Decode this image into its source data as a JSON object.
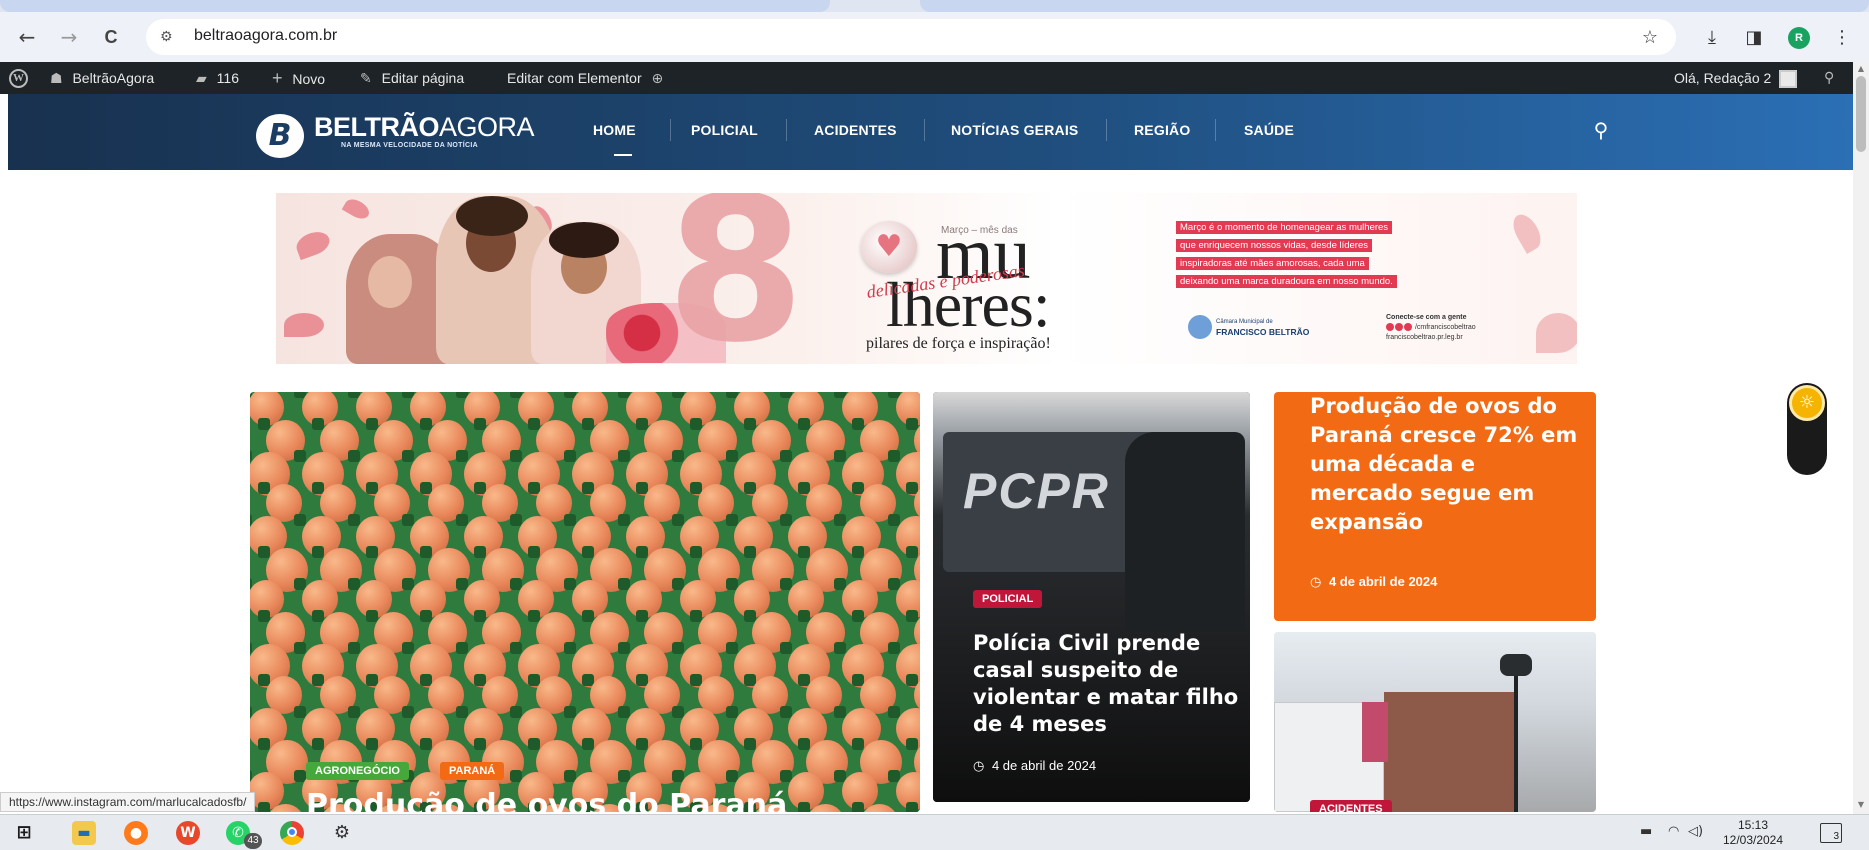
{
  "browser": {
    "url": "beltraoagora.com.br",
    "nav": {
      "back": "←",
      "forward": "→",
      "reload": "C"
    },
    "tools": {
      "bookmark": "☆",
      "download": "⤓",
      "sidebar": "◨",
      "profile_initial": "R",
      "menu": "⋮"
    }
  },
  "adminbar": {
    "site_name": "BeltrãoAgora",
    "comments_count": "116",
    "new_label": "Novo",
    "edit_page_label": "Editar página",
    "elementor_label": "Editar com Elementor",
    "greeting": "Olá, Redação 2"
  },
  "site": {
    "logo_bold": "BELTRÃO",
    "logo_light": "AGORA",
    "logo_mark": "B",
    "tagline": "NA MESMA VELOCIDADE DA NOTÍCIA",
    "menu": [
      "HOME",
      "POLICIAL",
      "ACIDENTES",
      "NOTÍCIAS GERAIS",
      "REGIÃO",
      "SAÚDE"
    ]
  },
  "banner": {
    "number": "8",
    "marco_small": "Março – mês das",
    "word_top": "mu",
    "word_bottom": "lheres:",
    "script": "delicadas e poderosas",
    "subtitle": "pilares de força e inspiração!",
    "lines": [
      "Março é o momento de homenagear as mulheres",
      "que enriquecem nossos vidas, desde líderes",
      "inspiradoras até mães amorosas, cada uma",
      "deixando uma marca duradoura em nosso mundo."
    ],
    "org_small": "Câmara Municipal de",
    "org": "FRANCISCO BELTRÃO",
    "connect": "Conecte-se com a gente",
    "handle": "/cmfranciscobeltrao",
    "site": "franciscobeltrao.pr.leg.br"
  },
  "cards": {
    "main": {
      "tags": [
        "AGRONEGÓCIO",
        "PARANÁ"
      ],
      "title_partial": "Produção de ovos do Paraná"
    },
    "police": {
      "tag": "POLICIAL",
      "title": "Polícia Civil prende casal suspeito de violentar e matar filho de 4 meses",
      "date": "4 de abril de 2024"
    },
    "eggs2": {
      "title": "Produção de ovos do Paraná cresce 72% em uma década e mercado segue em expansão",
      "date": "4 de abril de 2024"
    },
    "street": {
      "tag": "ACIDENTES"
    }
  },
  "status_url": "https://www.instagram.com/marlucalcadosfb/",
  "taskbar": {
    "whatsapp_badge": "43",
    "time": "15:13",
    "date": "12/03/2024",
    "notifications": "3"
  },
  "colors": {
    "orange": "#f26a13",
    "police_tag": "#c0163a",
    "agro_tag": "#46a83b",
    "parana_tag": "#f26a13",
    "header_dark": "#18314f",
    "header_light": "#2b6fb5"
  }
}
